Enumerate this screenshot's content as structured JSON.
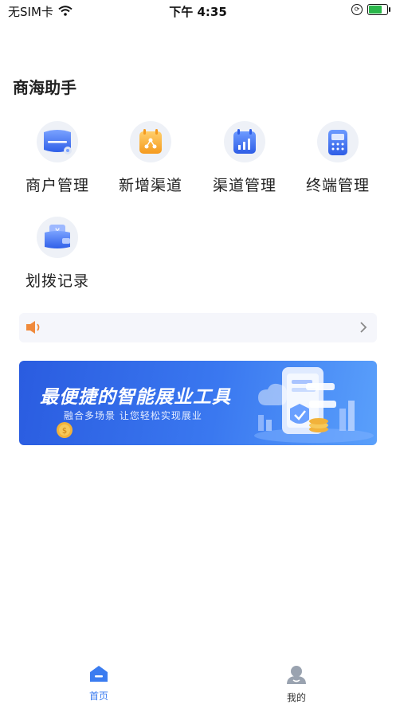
{
  "status_bar": {
    "carrier": "无SIM卡",
    "time": "下午 4:35",
    "battery_level": 0.8,
    "battery_color": "#2ab64a"
  },
  "page": {
    "title": "商海助手"
  },
  "grid": [
    {
      "label": "商户管理",
      "icon": "merchant-icon"
    },
    {
      "label": "新增渠道",
      "icon": "add-channel-icon"
    },
    {
      "label": "渠道管理",
      "icon": "channel-manage-icon"
    },
    {
      "label": "终端管理",
      "icon": "terminal-icon"
    },
    {
      "label": "划拨记录",
      "icon": "transfer-record-icon"
    }
  ],
  "notice": {
    "text": "",
    "icon": "speaker-icon"
  },
  "banner": {
    "title": "最便捷的智能展业工具",
    "subtitle": "融合多场景  让您轻松实现展业"
  },
  "tabs": [
    {
      "label": "首页",
      "icon": "home-icon",
      "active": true
    },
    {
      "label": "我的",
      "icon": "profile-icon",
      "active": false
    }
  ],
  "colors": {
    "accent": "#3b7cf0",
    "tab_inactive": "#9aa3b0",
    "banner_start": "#2a5ce0",
    "banner_end": "#5aa0fb"
  }
}
